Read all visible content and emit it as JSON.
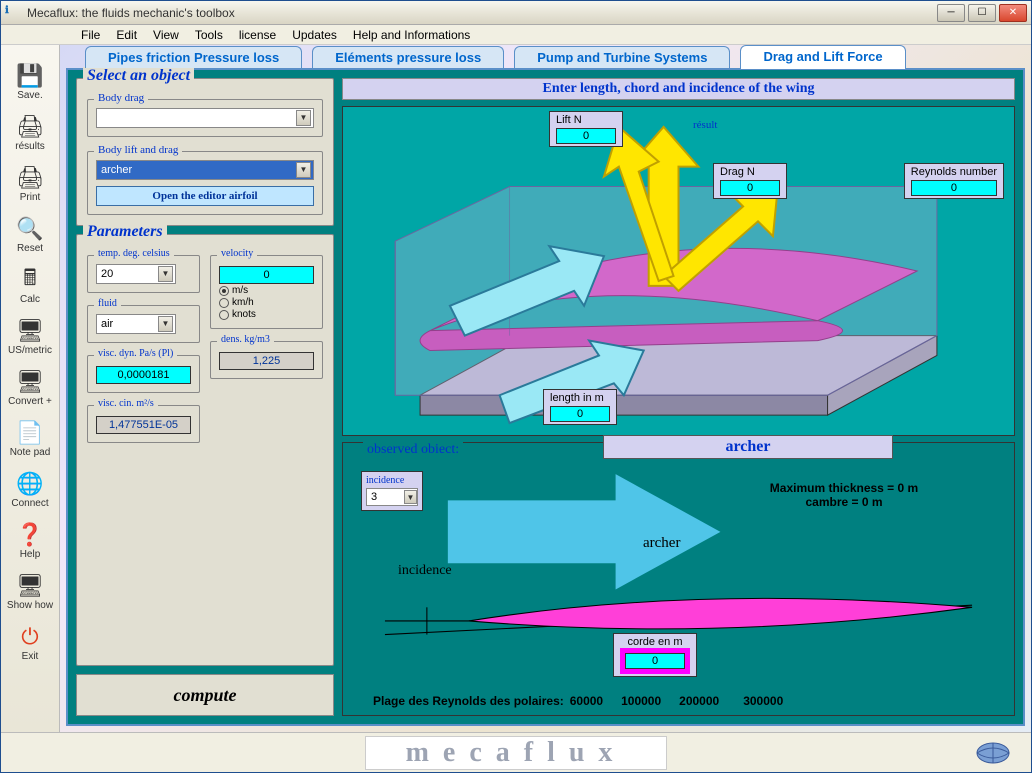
{
  "window": {
    "title": "Mecaflux: the fluids mechanic's toolbox"
  },
  "menu": {
    "file": "File",
    "edit": "Edit",
    "view": "View",
    "tools": "Tools",
    "license": "license",
    "updates": "Updates",
    "help": "Help and Informations"
  },
  "toolbar": {
    "save": "Save.",
    "results": "résults",
    "print": "Print",
    "reset": "Reset",
    "calc": "Calc",
    "usmetric": "US/metric",
    "convert": "Convert +",
    "notepad": "Note pad",
    "connect": "Connect",
    "help": "Help",
    "showhow": "Show how",
    "exit": "Exit"
  },
  "tabs": {
    "pipes": "Pipes friction Pressure loss",
    "elements": "Eléments pressure loss",
    "pump": "Pump and Turbine Systems",
    "drag": "Drag and Lift Force"
  },
  "select_panel": {
    "title": "Select an object",
    "body_drag_label": "Body drag",
    "body_drag_value": "",
    "body_lift_label": "Body lift and drag",
    "body_lift_value": "archer",
    "editor_btn": "Open the editor airfoil"
  },
  "params": {
    "title": "Parameters",
    "temp_label": "temp. deg. celsius",
    "temp_value": "20",
    "fluid_label": "fluid",
    "fluid_value": "air",
    "visc_dyn_label": "visc. dyn. Pa/s (Pl)",
    "visc_dyn_value": "0,0000181",
    "visc_cin_label": "visc. cin. m²/s",
    "visc_cin_value": "1,477551E-05",
    "velocity_label": "velocity",
    "velocity_value": "0",
    "unit_ms": "m/s",
    "unit_kmh": "km/h",
    "unit_knots": "knots",
    "dens_label": "dens. kg/m3",
    "dens_value": "1,225"
  },
  "compute": "compute",
  "diagram": {
    "header": "Enter length, chord and incidence of the wing",
    "lift_label": "Lift N",
    "lift_val": "0",
    "drag_label": "Drag N",
    "drag_val": "0",
    "reynolds_label": "Reynolds number",
    "reynolds_val": "0",
    "length_label": "length in m",
    "length_val": "0",
    "result_label": "résult"
  },
  "observed": {
    "legend": "observed obiect:",
    "name": "archer",
    "incidence_label": "incidence",
    "incidence_val": "3",
    "incidence_text": "incidence",
    "profile_name": "archer",
    "max_thickness": "Maximum thickness = 0 m",
    "cambre": "cambre = 0 m",
    "corde_label": "corde en m",
    "corde_val": "0",
    "reynolds_range_label": "Plage des Reynolds des polaires:",
    "r1": "60000",
    "r2": "100000",
    "r3": "200000",
    "r4": "300000"
  },
  "footer": {
    "brand": "mecaflux"
  }
}
